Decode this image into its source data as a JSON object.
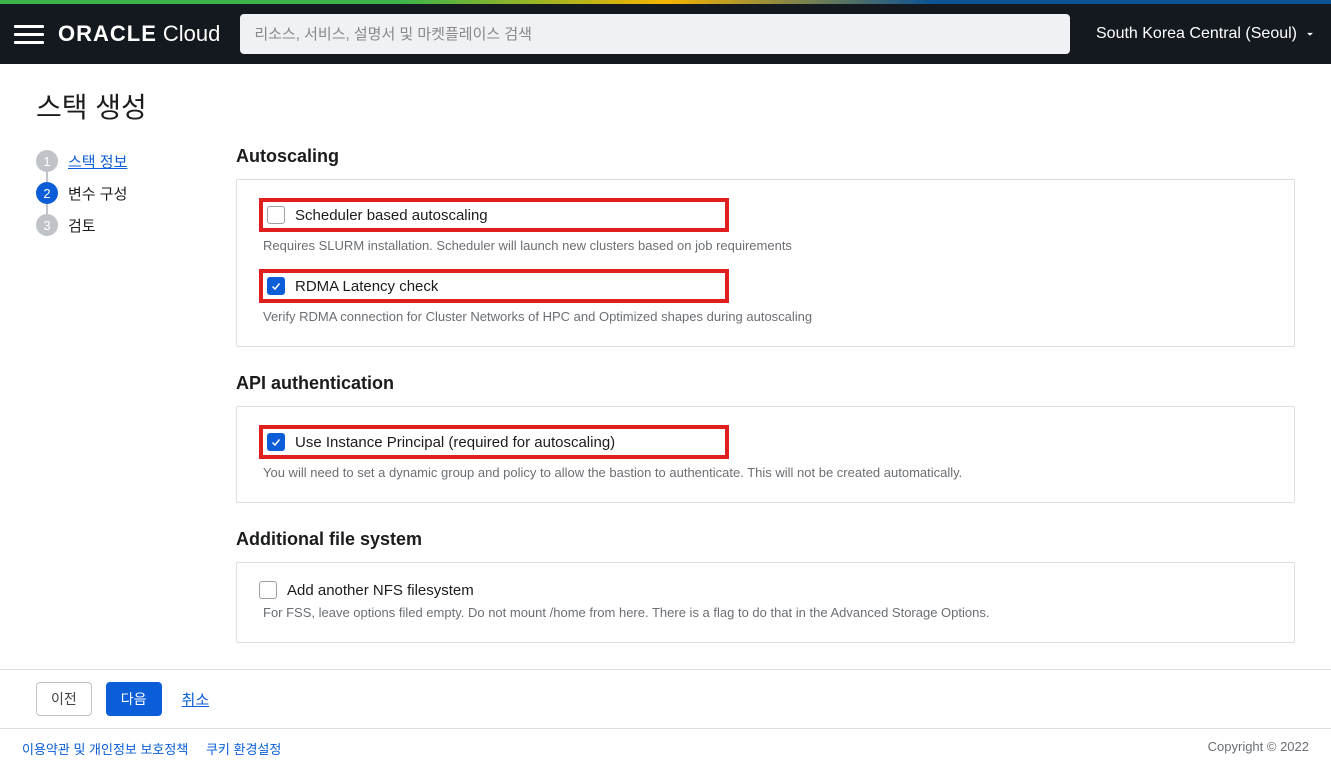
{
  "header": {
    "brand_oracle": "ORACLE",
    "brand_cloud": "Cloud",
    "search_placeholder": "리소스, 서비스, 설명서 및 마켓플레이스 검색",
    "region": "South Korea Central (Seoul)"
  },
  "page_title": "스택 생성",
  "steps": [
    {
      "num": "1",
      "label": "스택 정보",
      "state": "completed"
    },
    {
      "num": "2",
      "label": "변수 구성",
      "state": "active"
    },
    {
      "num": "3",
      "label": "검토",
      "state": "upcoming"
    }
  ],
  "sections": {
    "autoscaling": {
      "title": "Autoscaling",
      "options": [
        {
          "label": "Scheduler based autoscaling",
          "desc": "Requires SLURM installation. Scheduler will launch new clusters based on job requirements",
          "checked": false,
          "highlighted": true
        },
        {
          "label": "RDMA Latency check",
          "desc": "Verify RDMA connection for Cluster Networks of HPC and Optimized shapes during autoscaling",
          "checked": true,
          "highlighted": true
        }
      ]
    },
    "api_auth": {
      "title": "API authentication",
      "options": [
        {
          "label": "Use Instance Principal (required for autoscaling)",
          "desc": "You will need to set a dynamic group and policy to allow the bastion to authenticate. This will not be created automatically.",
          "checked": true,
          "highlighted": true
        }
      ]
    },
    "add_fs": {
      "title": "Additional file system",
      "options": [
        {
          "label": "Add another NFS filesystem",
          "desc": "For FSS, leave options filed empty. Do not mount /home from here. There is a flag to do that in the Advanced Storage Options.",
          "checked": false,
          "highlighted": false
        }
      ]
    }
  },
  "buttons": {
    "prev": "이전",
    "next": "다음",
    "cancel": "취소"
  },
  "footer": {
    "terms": "이용약관 및 개인정보 보호정책",
    "cookies": "쿠키 환경설정",
    "copy": "Copyright © 2022"
  }
}
